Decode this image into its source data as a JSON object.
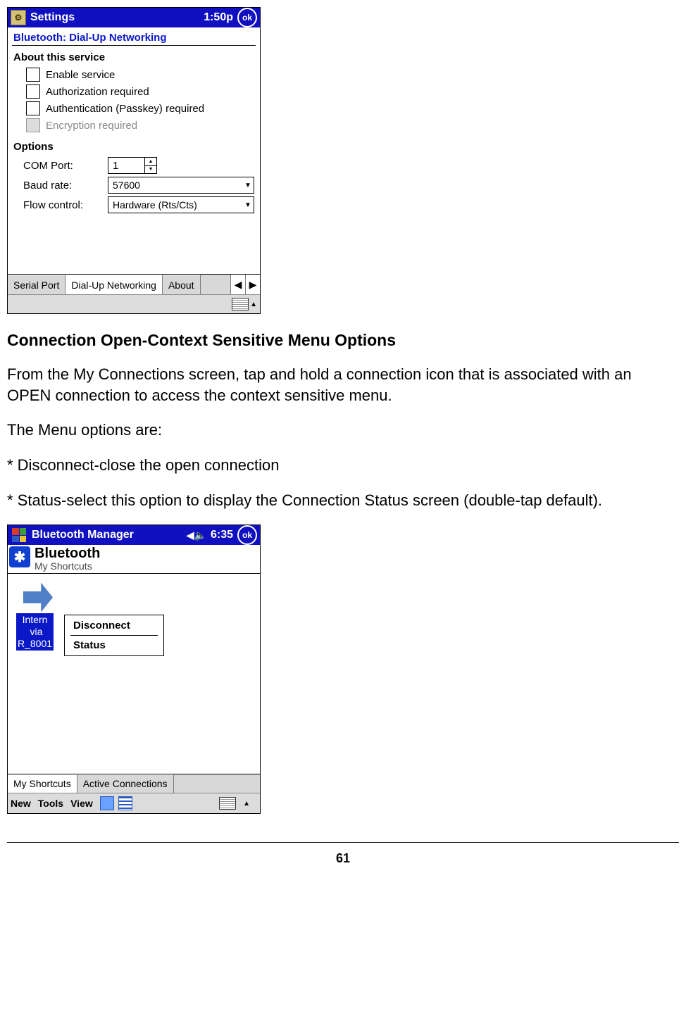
{
  "settings": {
    "title": "Settings",
    "time": "1:50p",
    "ok": "ok",
    "heading": "Bluetooth: Dial-Up Networking",
    "section_about": "About this service",
    "cb_enable": "Enable service",
    "cb_auth": "Authorization required",
    "cb_authn": "Authentication (Passkey) required",
    "cb_enc": "Encryption required",
    "section_options": "Options",
    "com_label": "COM Port:",
    "com_value": "1",
    "baud_label": "Baud rate:",
    "baud_value": "57600",
    "flow_label": "Flow control:",
    "flow_value": "Hardware (Rts/Cts)",
    "tabs": [
      "Serial Port",
      "Dial-Up Networking",
      "About"
    ]
  },
  "doc": {
    "h": "Connection Open-Context Sensitive Menu Options",
    "p1": "From the My Connections screen, tap and hold a connection icon that is associated with an OPEN connection to access the context sensitive menu.",
    "p2": "The Menu options are:",
    "p3": "* Disconnect-close the open connection",
    "p4": "* Status-select this option to display the Connection Status screen (double-tap default)."
  },
  "manager": {
    "title": "Bluetooth Manager",
    "time": "6:35",
    "ok": "ok",
    "brand": "Bluetooth",
    "subtitle": "My Shortcuts",
    "shortcut_label": "Intern\n via\nR_8001",
    "ctx_disconnect": "Disconnect",
    "ctx_status": "Status",
    "tabs": [
      "My Shortcuts",
      "Active Connections"
    ],
    "menu": [
      "New",
      "Tools",
      "View"
    ]
  },
  "page_number": "61"
}
